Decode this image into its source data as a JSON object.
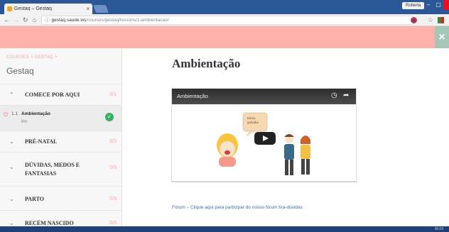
{
  "browser": {
    "tab_title": "Gestaq – Gestaq",
    "tab_close": "×",
    "user_badge": "Roberta",
    "url_host": "gestaq.saude.ws",
    "url_path": "/courses/gestaq/lessons/1-ambientacao/",
    "win_min": "–",
    "win_max": "▢",
    "win_close": "×"
  },
  "banner": {
    "close": "×"
  },
  "sidebar": {
    "breadcrumb": "COURSES > GESTAQ >",
    "course_name": "Gestaq",
    "sections": [
      {
        "title": "COMECE POR AQUI",
        "count": "0/1",
        "chevron": "⌃"
      },
      {
        "title": "PRÉ-NATAL",
        "count": "0/3",
        "chevron": "⌄"
      },
      {
        "title": "DÚVIDAS, MEDOS E FANTASIAS",
        "count": "0/3",
        "chevron": "⌄"
      },
      {
        "title": "PARTO",
        "count": "0/3",
        "chevron": "⌄"
      },
      {
        "title": "RECÉM NASCIDO",
        "count": "0/3",
        "chevron": "⌄"
      }
    ],
    "lesson": {
      "number": "1.1",
      "name": "Ambientação",
      "duration": "6m",
      "check": "✓"
    }
  },
  "main": {
    "title": "Ambientação",
    "video": {
      "title": "Ambientação",
      "bubble": "Estou grávida!"
    },
    "forum_link": "Fórum – Clique aqui para participar do nosso fórum tira-dúvidas"
  },
  "taskbar": {
    "time": "16:19"
  },
  "colors": {
    "banner": "#ffb2a9",
    "accent": "#f5a599",
    "check": "#3aae5c",
    "link": "#3c6fb4"
  }
}
